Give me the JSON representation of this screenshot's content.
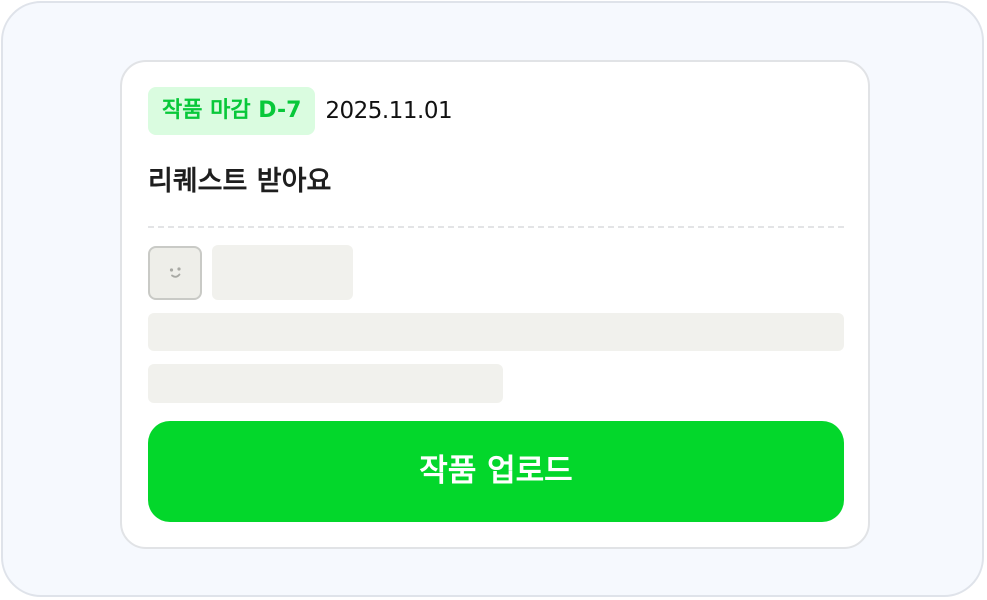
{
  "card": {
    "deadline_badge": "작품 마감 D-7",
    "date": "2025.11.01",
    "title": "리퀘스트 받아요"
  },
  "avatar": {
    "icon": "smiley-placeholder-icon"
  },
  "upload_button": {
    "label": "작품 업로드"
  },
  "colors": {
    "accent": "#03d72b",
    "badge_bg": "#dafce0",
    "badge_text": "#08c83a",
    "skeleton": "#f1f1ed",
    "outer_bg": "#f6f9fe"
  }
}
